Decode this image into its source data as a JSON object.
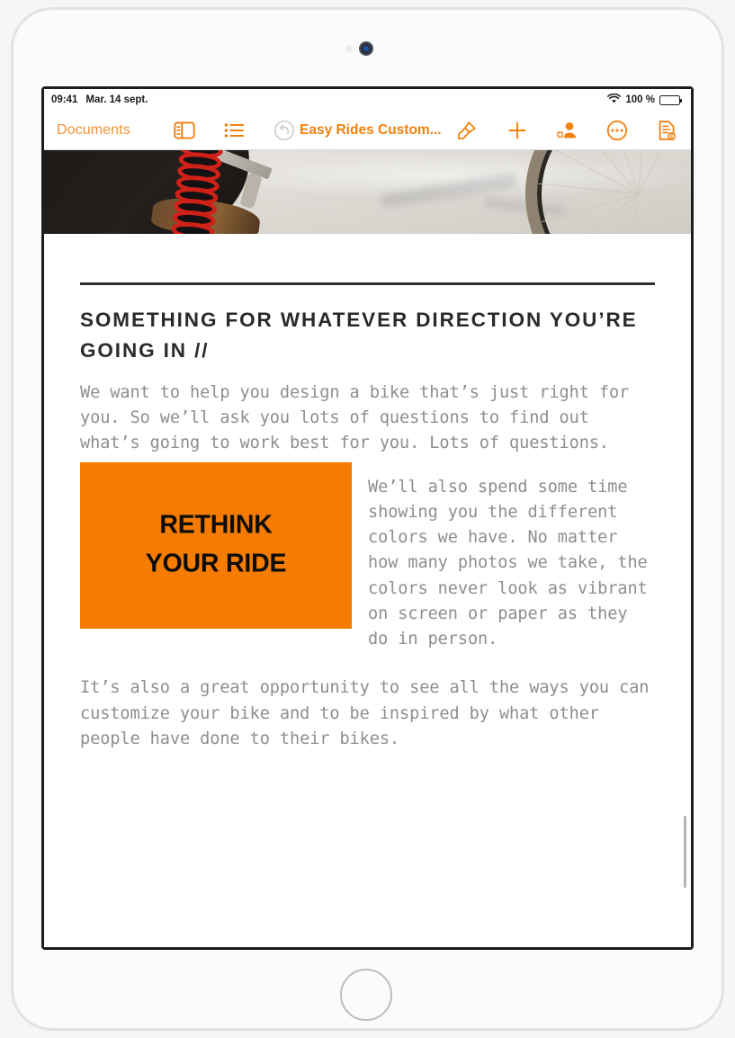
{
  "device": {
    "name": "ipad",
    "camera_icon": "camera-icon",
    "sensor_icon": "ambient-light-sensor-icon",
    "home_button_label": "Home"
  },
  "status_bar": {
    "time": "09:41",
    "date": "Mar. 14 sept.",
    "wifi_icon": "wifi-icon",
    "battery_percent": "100 %",
    "battery_icon": "battery-full-icon"
  },
  "toolbar": {
    "back_label": "Documents",
    "sidebar_icon": "sidebar-icon",
    "list_icon": "list-view-icon",
    "undo_icon": "undo-icon",
    "undo_state": "disabled",
    "title": "Easy Rides Custom...",
    "format_icon": "paintbrush-icon",
    "insert_icon": "plus-icon",
    "collaborate_icon": "add-person-icon",
    "more_icon": "ellipsis-circle-icon",
    "document_options_icon": "document-preview-icon",
    "accent_color": "#f2800d"
  },
  "document": {
    "banner_image_alt": "bicycle-wheel-photo",
    "heading": "SOMETHING FOR WHATEVER DIRECTION YOU’RE GOING IN //",
    "paragraphs": [
      "We want to help you design a bike that’s just right for you. So we’ll ask you lots of questions to find out what’s going to work best for you. Lots of questions.",
      "We’ll also spend some time showing you the different colors we have. No matter how many photos we take, the colors never look as vibrant on screen or paper as they do in person.",
      "It’s also a great opportunity to see all the ways you can customize your bike and to be inspired by what other people have done to their bikes."
    ],
    "inline_image": {
      "name": "rethink-your-ride-image",
      "line_1": "RETHINK",
      "line_2": "YOUR RIDE",
      "background_color": "#f57c00",
      "text_color": "#0d0d0d"
    },
    "rule_color": "#2f2f2f",
    "body_text_color": "#8e8e8e"
  }
}
